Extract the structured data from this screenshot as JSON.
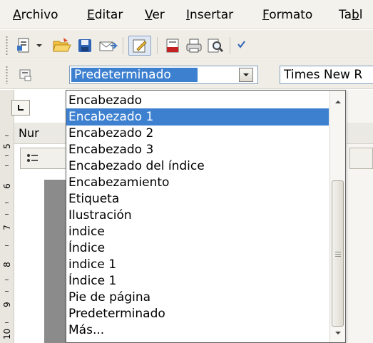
{
  "menubar": {
    "items": [
      {
        "pre": "",
        "u": "A",
        "post": "rchivo"
      },
      {
        "pre": "",
        "u": "E",
        "post": "ditar"
      },
      {
        "pre": "",
        "u": "V",
        "post": "er"
      },
      {
        "pre": "",
        "u": "I",
        "post": "nsertar"
      },
      {
        "pre": "",
        "u": "F",
        "post": "ormato"
      },
      {
        "pre": "Ta",
        "u": "b",
        "post": "l"
      }
    ]
  },
  "format_toolbar": {
    "paragraph_style": "Predeterminado",
    "font_name": "Times New R"
  },
  "ruler": {
    "numbers": [
      "5",
      "6",
      "7",
      "8",
      "9",
      "10"
    ]
  },
  "navigator": {
    "header": "Nur"
  },
  "style_dropdown": {
    "options": [
      "Encabezado",
      "Encabezado 1",
      "Encabezado 2",
      "Encabezado 3",
      "Encabezado del índice",
      "Encabezamiento",
      "Etiqueta",
      "Ilustración",
      "indice",
      "Índice",
      "indice 1",
      "Índice 1",
      "Pie de página",
      "Predeterminado",
      "Más..."
    ],
    "selected_option": "Encabezado 1"
  },
  "colors": {
    "selection": "#3d80d0",
    "toolbar_bg": "#efede6"
  }
}
